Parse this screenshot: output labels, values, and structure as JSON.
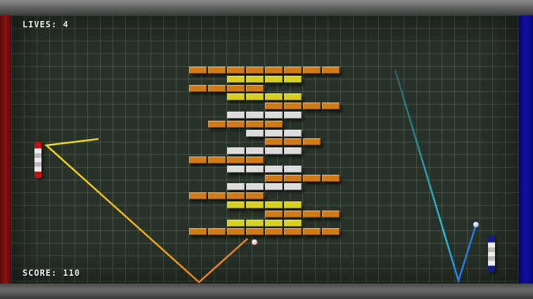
{
  "hud": {
    "lives_text": "LIVES: 4",
    "score_text": "SCORE: 110"
  },
  "colors": {
    "left_wall": "#8a1010",
    "right_wall": "#1010a8",
    "brick_orange": "#d07a18",
    "brick_yellow": "#d8d020",
    "brick_silver": "#dcdcdc",
    "trail_yellow": "#f0e020",
    "trail_orange": "#f08020",
    "trail_cyan": "#30c0e0",
    "trail_blue": "#2050f0"
  },
  "bricks": [
    {
      "row": 0,
      "cols": [
        0,
        1,
        2,
        3,
        4,
        5,
        6,
        7
      ],
      "color": "orange"
    },
    {
      "row": 1,
      "cols": [
        2,
        3,
        4,
        5
      ],
      "color": "yellow"
    },
    {
      "row": 2,
      "cols": [
        0,
        1,
        2,
        3
      ],
      "color": "orange"
    },
    {
      "row": 3,
      "cols": [
        2,
        3,
        4,
        5
      ],
      "color": "yellow"
    },
    {
      "row": 4,
      "cols": [
        4,
        5,
        6,
        7
      ],
      "color": "orange"
    },
    {
      "row": 5,
      "cols": [
        2,
        3,
        4,
        5
      ],
      "color": "silver"
    },
    {
      "row": 6,
      "cols": [
        1,
        2,
        3,
        4
      ],
      "color": "orange"
    },
    {
      "row": 7,
      "cols": [
        3,
        4,
        5
      ],
      "color": "silver"
    },
    {
      "row": 8,
      "cols": [
        4,
        5,
        6
      ],
      "color": "orange"
    },
    {
      "row": 9,
      "cols": [
        2,
        3,
        4,
        5
      ],
      "color": "silver"
    },
    {
      "row": 10,
      "cols": [
        0,
        1,
        2,
        3
      ],
      "color": "orange"
    },
    {
      "row": 11,
      "cols": [
        2,
        3,
        4,
        5
      ],
      "color": "silver"
    },
    {
      "row": 12,
      "cols": [
        4,
        5,
        6,
        7
      ],
      "color": "orange"
    },
    {
      "row": 13,
      "cols": [
        2,
        3,
        4,
        5
      ],
      "color": "silver"
    },
    {
      "row": 14,
      "cols": [
        0,
        1,
        2,
        3
      ],
      "color": "orange"
    },
    {
      "row": 15,
      "cols": [
        2,
        3,
        4,
        5
      ],
      "color": "yellow"
    },
    {
      "row": 16,
      "cols": [
        4,
        5,
        6,
        7
      ],
      "color": "orange"
    },
    {
      "row": 17,
      "cols": [
        2,
        3,
        4,
        5
      ],
      "color": "yellow"
    },
    {
      "row": 18,
      "cols": [
        0,
        1,
        2,
        3,
        4,
        5,
        6,
        7
      ],
      "color": "orange"
    }
  ]
}
